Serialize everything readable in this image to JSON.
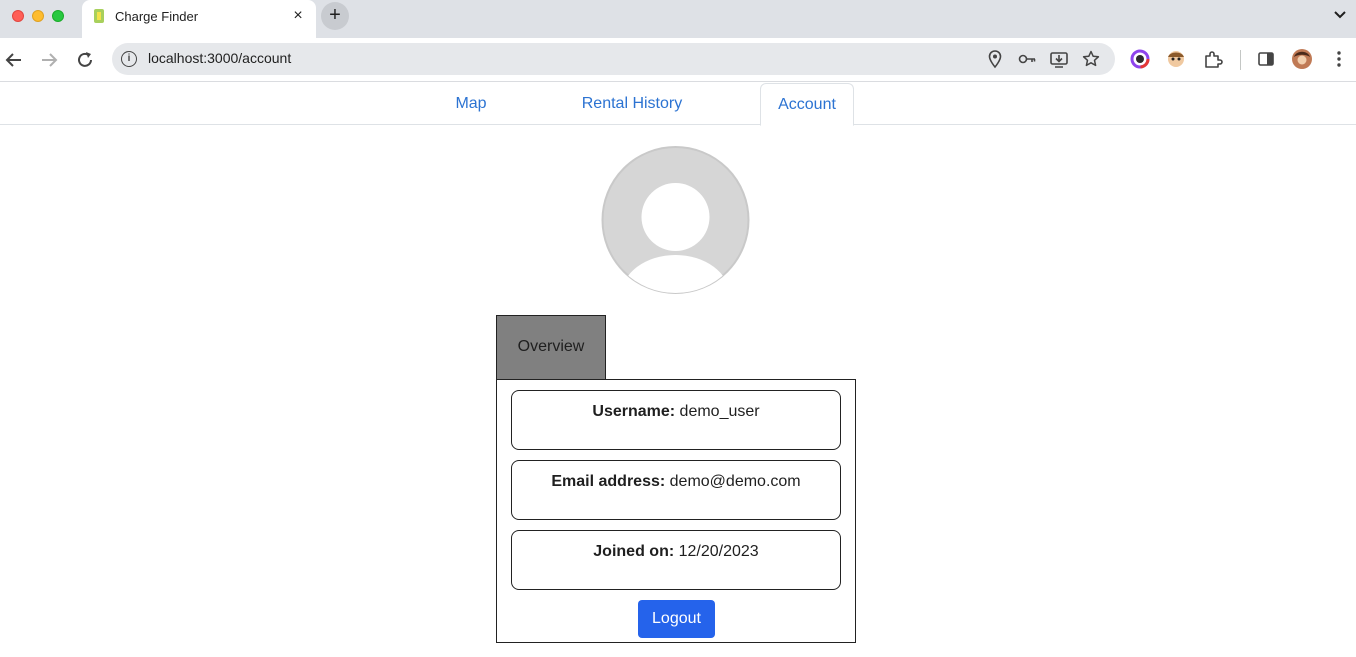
{
  "browser": {
    "tab_title": "Charge Finder",
    "tab_close": "×",
    "new_tab": "+",
    "url": "localhost:3000/account",
    "info_icon_glyph": "i"
  },
  "nav": {
    "tabs": [
      {
        "label": "Map"
      },
      {
        "label": "Rental History"
      },
      {
        "label": "Account",
        "active": true
      }
    ]
  },
  "account": {
    "section_tab": "Overview",
    "fields": [
      {
        "label": "Username:",
        "value": "demo_user"
      },
      {
        "label": "Email address:",
        "value": "demo@demo.com"
      },
      {
        "label": "Joined on:",
        "value": "12/20/2023"
      }
    ],
    "logout_label": "Logout"
  },
  "colors": {
    "accent": "#2c73d2",
    "button": "#2563eb",
    "overview_tab_bg": "#808080",
    "avatar": "#d6d6d6"
  }
}
